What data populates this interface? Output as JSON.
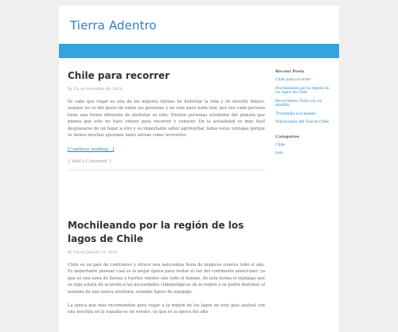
{
  "site": {
    "title": "Tierra Adentro"
  },
  "posts": [
    {
      "title": "Chile para recorrer",
      "meta": "By Tia on November 06, 2014",
      "body": "Se sabe que viajar es una de las mejores formas de disfrutar la vida y de invertir dinero, aunque no es del gusto de todas las personas y no este para nada mal, por eso cada persona tiene una forma diferente de disfrutar su vida. Existen personas alrededor del planeta que piensa que este no hace entero para recorrer y conocer. En la actualidad es muy fácil desplazarse de un lugar a otro y es importante saber aprovechar todas estas ventajas porque se tienen muchas opciones tanto aéreas como terrestres.",
      "read_more": "[Continue reading...]",
      "comment": "{ Add a Comment }"
    },
    {
      "title": "Mochileando por la región de los lagos de Chile",
      "meta": "By Tia on January 11, 2014",
      "body": "Chile es un país de contrastes y ofrece una naturaleza llena de mágicos colores todo el año. Es importante planear cual es la mejor época para visitar el sur del continente americano: ya que es una zona de lluvias y fuertes vientos une todo el tiempo, de esta forma el equipaje que se elija estará de acuerdo a las necesidades climatológicas de la región y se podrá disfrutar al máximo de una nueva aventura, estando ligero de equipaje.",
      "body2": "La época que más recomiendan para viajar a la región de los lagos en este país austral con una mochila en la espalda es en verano, ya que es la época del año"
    }
  ],
  "sidebar": {
    "recent_heading": "Recent Posts",
    "recent": [
      "Chile para recorrer",
      "Mochileando por la región de los lagos de Chile",
      "Recorriendo Chile con un mochila",
      "Trecemilla a el mundo",
      "Maravsando del Sud en Chile"
    ],
    "categories_heading": "Categories",
    "categories": [
      "Chile",
      "Juez"
    ]
  }
}
